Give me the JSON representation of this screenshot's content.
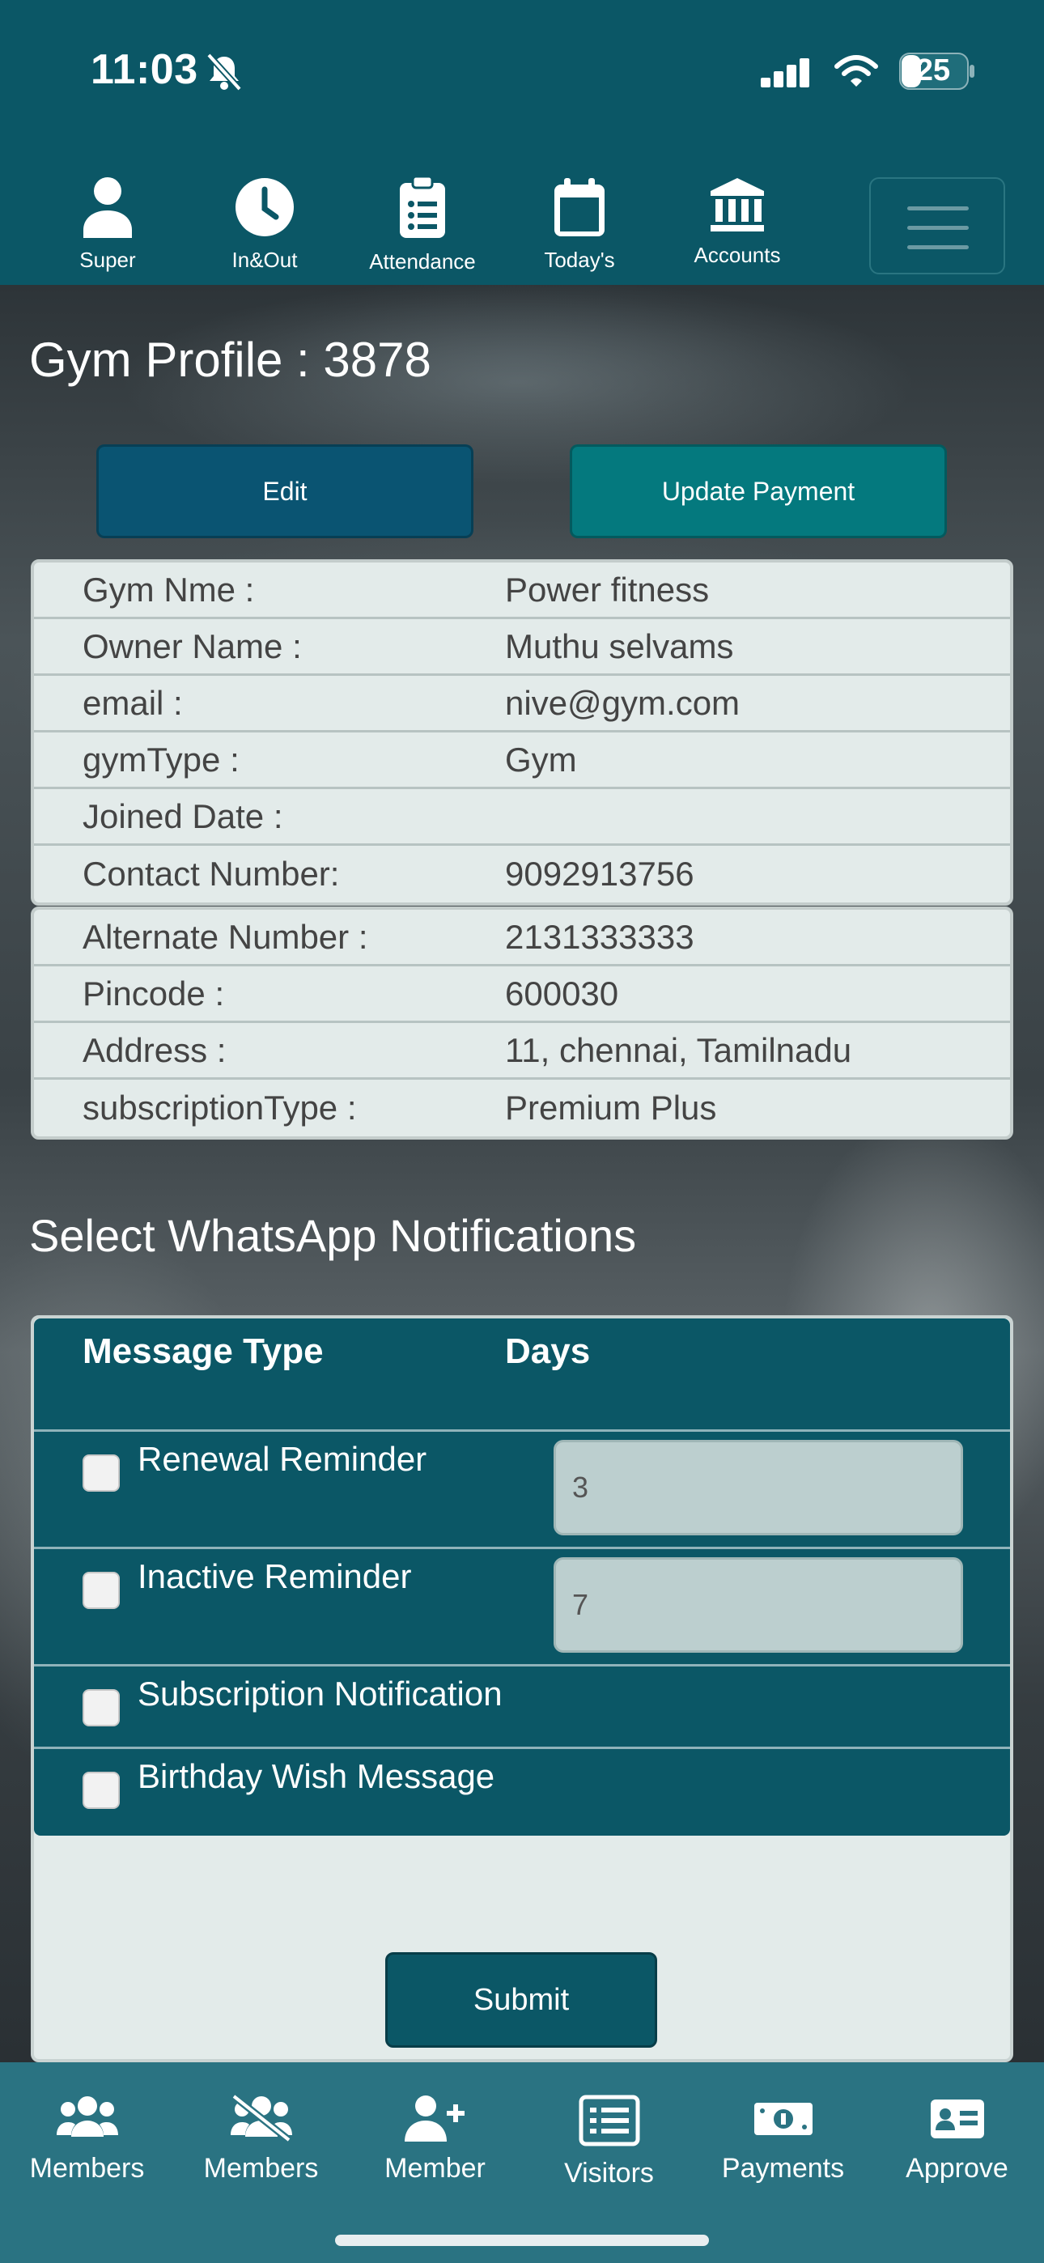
{
  "status_bar": {
    "time": "11:03",
    "battery": "25"
  },
  "top_nav": {
    "items": [
      {
        "label": "Super",
        "icon": "user-icon"
      },
      {
        "label": "In&Out",
        "icon": "clock-icon"
      },
      {
        "label": "Attendance",
        "icon": "clipboard-icon"
      },
      {
        "label": "Today's",
        "icon": "calendar-icon"
      },
      {
        "label": "Accounts",
        "icon": "bank-icon"
      }
    ]
  },
  "page": {
    "title": "Gym Profile : 3878",
    "edit_label": "Edit",
    "update_payment_label": "Update Payment"
  },
  "profile": {
    "table1": [
      {
        "label": "Gym Nme :",
        "value": "Power fitness"
      },
      {
        "label": "Owner Name :",
        "value": "Muthu selvams"
      },
      {
        "label": "email :",
        "value": "nive@gym.com"
      },
      {
        "label": "gymType :",
        "value": "Gym"
      },
      {
        "label": "Joined Date :",
        "value": ""
      },
      {
        "label": "Contact Number:",
        "value": "9092913756"
      }
    ],
    "table2": [
      {
        "label": "Alternate Number :",
        "value": "2131333333"
      },
      {
        "label": "Pincode :",
        "value": "600030"
      },
      {
        "label": "Address :",
        "value": "11, chennai, Tamilnadu"
      },
      {
        "label": "subscriptionType :",
        "value": "Premium Plus"
      }
    ]
  },
  "notifications": {
    "title": "Select WhatsApp Notifications",
    "col_message_type": "Message Type",
    "col_days": "Days",
    "rows": [
      {
        "label": "Renewal Reminder",
        "days": "3",
        "checked": false
      },
      {
        "label": "Inactive Reminder",
        "days": "7",
        "checked": false
      },
      {
        "label": "Subscription Notification",
        "checked": false
      },
      {
        "label": "Birthday Wish Message",
        "checked": false
      }
    ],
    "submit_label": "Submit"
  },
  "bottom_nav": {
    "items": [
      {
        "label": "Members",
        "icon": "members-icon"
      },
      {
        "label": "Members",
        "icon": "members-off-icon"
      },
      {
        "label": "Member",
        "icon": "add-member-icon"
      },
      {
        "label": "Visitors",
        "icon": "list-icon"
      },
      {
        "label": "Payments",
        "icon": "money-icon"
      },
      {
        "label": "Approve",
        "icon": "id-card-icon"
      }
    ]
  },
  "colors": {
    "header": "#0b5766",
    "edit_button": "#0a5472",
    "update_payment_button": "#04797e",
    "bottom_nav": "#2a7382",
    "table_bg": "#e3ebea"
  }
}
